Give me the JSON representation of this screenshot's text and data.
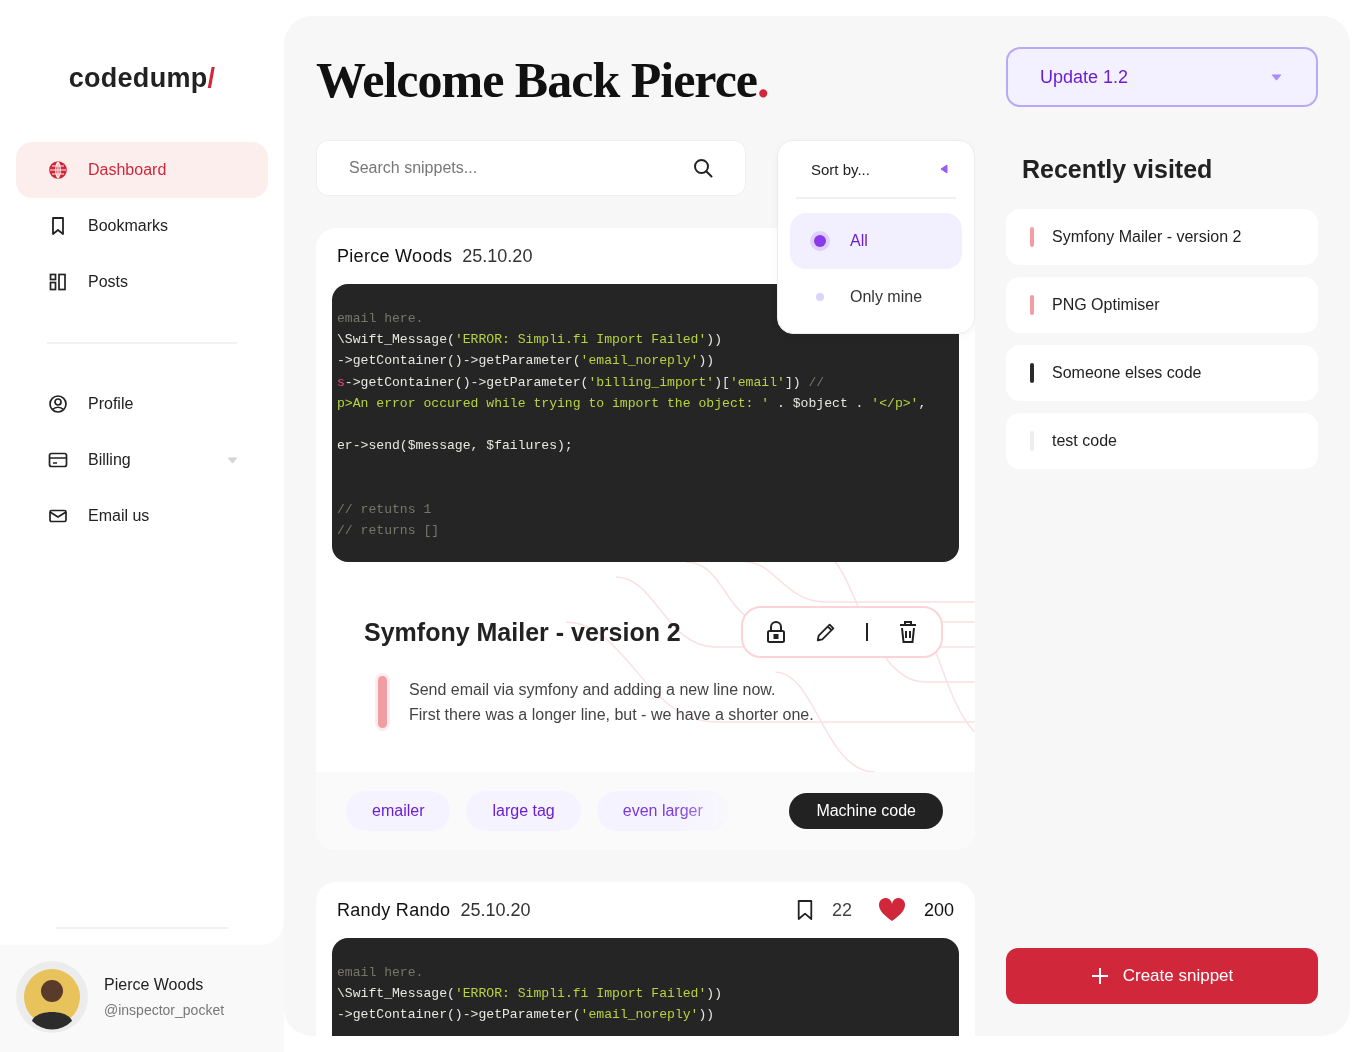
{
  "logo": {
    "text": "codedump",
    "mark": "/"
  },
  "nav": [
    {
      "label": "Dashboard",
      "selected": true
    },
    {
      "label": "Bookmarks",
      "selected": false
    },
    {
      "label": "Posts",
      "selected": false
    }
  ],
  "nav_secondary": [
    {
      "label": "Profile",
      "selected": false,
      "expandable": false
    },
    {
      "label": "Billing",
      "selected": false,
      "expandable": true
    },
    {
      "label": "Email us",
      "selected": false,
      "expandable": false
    }
  ],
  "user": {
    "name": "Pierce Woods",
    "handle": "@inspector_pocket"
  },
  "heading": {
    "text": "Welcome Back Pierce",
    "mark": "."
  },
  "search": {
    "placeholder": "Search snippets..."
  },
  "sort": {
    "label": "Sort by...",
    "options": [
      {
        "label": "All",
        "selected": true
      },
      {
        "label": "Only mine",
        "selected": false
      }
    ]
  },
  "posts": [
    {
      "author": "Pierce Woods",
      "date": "25.10.20",
      "code": [
        {
          "kind": "code",
          "segments": [
            {
              "kind": "comment",
              "t": "email here."
            }
          ]
        },
        {
          "kind": "code",
          "segments": [
            {
              "kind": "plain",
              "t": "\\Swift_Message("
            },
            {
              "kind": "string",
              "t": "'ERROR: Simpli.fi Import Failed'"
            },
            {
              "kind": "plain",
              "t": "))"
            }
          ]
        },
        {
          "kind": "code",
          "segments": [
            {
              "kind": "plain",
              "t": "->getContainer()->getParameter("
            },
            {
              "kind": "string",
              "t": "'email_noreply'"
            },
            {
              "kind": "plain",
              "t": "))"
            }
          ]
        },
        {
          "kind": "code",
          "segments": [
            {
              "kind": "keyword",
              "t": "s"
            },
            {
              "kind": "plain",
              "t": "->getContainer()->getParameter("
            },
            {
              "kind": "string",
              "t": "'billing_import'"
            },
            {
              "kind": "plain",
              "t": ")["
            },
            {
              "kind": "string",
              "t": "'email'"
            },
            {
              "kind": "plain",
              "t": "]) "
            },
            {
              "kind": "comment",
              "t": "//"
            }
          ]
        },
        {
          "kind": "code",
          "segments": [
            {
              "kind": "string",
              "t": "p>An error occured while trying to import the object: '"
            },
            {
              "kind": "plain",
              "t": " . $object . "
            },
            {
              "kind": "string",
              "t": "'</p>'"
            },
            {
              "kind": "plain",
              "t": ","
            }
          ]
        },
        {
          "kind": "blank"
        },
        {
          "kind": "code",
          "segments": [
            {
              "kind": "plain",
              "t": "er->send($message, $failures);"
            }
          ]
        },
        {
          "kind": "blank"
        },
        {
          "kind": "blank"
        },
        {
          "kind": "code",
          "segments": [
            {
              "kind": "comment",
              "t": "// retutns 1"
            }
          ]
        },
        {
          "kind": "code",
          "segments": [
            {
              "kind": "comment",
              "t": "// returns []"
            }
          ]
        }
      ],
      "title": "Symfony Mailer - version 2",
      "description": [
        "Send email via symfony and adding a new line now.",
        "First there was a longer line, but - we have a shorter one."
      ],
      "tags": [
        {
          "label": "emailer",
          "kind": "tag"
        },
        {
          "label": "large tag",
          "kind": "tag"
        },
        {
          "label": "even larger",
          "kind": "faded"
        },
        {
          "label": "Machine code",
          "kind": "language"
        }
      ]
    },
    {
      "author": "Randy Rando",
      "date": "25.10.20",
      "bookmarks": "22",
      "likes": "200",
      "code": [
        {
          "kind": "code",
          "segments": [
            {
              "kind": "comment",
              "t": "email here."
            }
          ]
        },
        {
          "kind": "code",
          "segments": [
            {
              "kind": "plain",
              "t": "\\Swift_Message("
            },
            {
              "kind": "string",
              "t": "'ERROR: Simpli.fi Import Failed'"
            },
            {
              "kind": "plain",
              "t": "))"
            }
          ]
        },
        {
          "kind": "code",
          "segments": [
            {
              "kind": "plain",
              "t": "->getContainer()->getParameter("
            },
            {
              "kind": "string",
              "t": "'email_noreply'"
            },
            {
              "kind": "plain",
              "t": "))"
            }
          ]
        }
      ]
    }
  ],
  "update_select": {
    "value": "Update 1.2"
  },
  "recently_visited": {
    "title": "Recently visited",
    "items": [
      {
        "label": "Symfony Mailer - version 2",
        "color": "#f29ca3"
      },
      {
        "label": "PNG Optimiser",
        "color": "#f29ca3"
      },
      {
        "label": "Someone elses code",
        "color": "#2a2a2a"
      },
      {
        "label": "test code",
        "color": "#eeeeee"
      }
    ]
  },
  "create_button": {
    "label": "Create snippet"
  }
}
